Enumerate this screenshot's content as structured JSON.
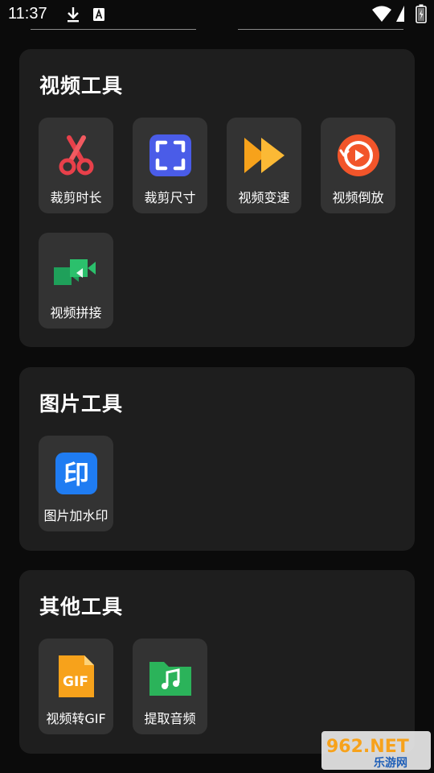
{
  "status_bar": {
    "time": "11:37"
  },
  "sections": [
    {
      "title": "视频工具",
      "tools": [
        {
          "label": "裁剪时长",
          "icon": "scissors-icon"
        },
        {
          "label": "裁剪尺寸",
          "icon": "crop-frame-icon"
        },
        {
          "label": "视频变速",
          "icon": "fast-forward-icon"
        },
        {
          "label": "视频倒放",
          "icon": "reverse-play-icon"
        },
        {
          "label": "视频拼接",
          "icon": "video-merge-icon"
        }
      ]
    },
    {
      "title": "图片工具",
      "tools": [
        {
          "label": "图片加水印",
          "icon": "stamp-icon",
          "glyph": "印"
        }
      ]
    },
    {
      "title": "其他工具",
      "tools": [
        {
          "label": "视频转GIF",
          "icon": "gif-file-icon",
          "glyph": "GIF"
        },
        {
          "label": "提取音频",
          "icon": "music-folder-icon"
        }
      ]
    }
  ],
  "watermark": {
    "brand": "962.NET",
    "subtitle": "乐游网"
  },
  "colors": {
    "background": "#0b0b0b",
    "card": "#1e1e1e",
    "tile": "#333333",
    "scissors": "#e8404a",
    "crop": "#4a5ce8",
    "speed": "#f7a21b",
    "reverse": "#f2552a",
    "merge": "#1fa05a",
    "stamp": "#1f7cf2",
    "gif": "#f7a21b",
    "music": "#2bb35a"
  }
}
